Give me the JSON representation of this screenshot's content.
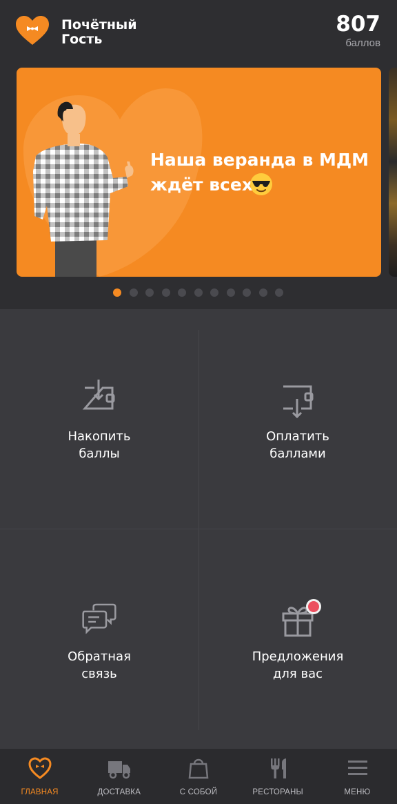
{
  "header": {
    "brand_line1": "Почётный",
    "brand_line2": "Гость",
    "points_value": "807",
    "points_label": "баллов",
    "logo_icon": "heart-bowtie-icon"
  },
  "banner": {
    "text_line1": "Наша веранда в МДМ",
    "text_line2": "ждёт всех",
    "emoji_icon": "sunglasses-emoji-icon",
    "slide_count": 11,
    "active_slide": 1
  },
  "tiles": [
    {
      "label": "Накопить\nбаллы",
      "icon": "wallet-in-icon"
    },
    {
      "label": "Оплатить\nбаллами",
      "icon": "wallet-out-icon"
    },
    {
      "label": "Обратная\nсвязь",
      "icon": "chat-bubbles-icon"
    },
    {
      "label": "Предложения\nдля вас",
      "icon": "gift-icon",
      "has_badge": true
    }
  ],
  "nav": [
    {
      "label": "ГЛАВНАЯ",
      "icon": "heart-bowtie-icon",
      "active": true
    },
    {
      "label": "ДОСТАВКА",
      "icon": "truck-icon"
    },
    {
      "label": "С СОБОЙ",
      "icon": "bag-icon"
    },
    {
      "label": "РЕСТОРАНЫ",
      "icon": "fork-knife-icon"
    },
    {
      "label": "МЕНЮ",
      "icon": "hamburger-menu-icon"
    }
  ],
  "colors": {
    "accent": "#f58a22",
    "background": "#2e2e31",
    "tile_background": "#3a3a3e",
    "badge": "#ec4f5f"
  }
}
